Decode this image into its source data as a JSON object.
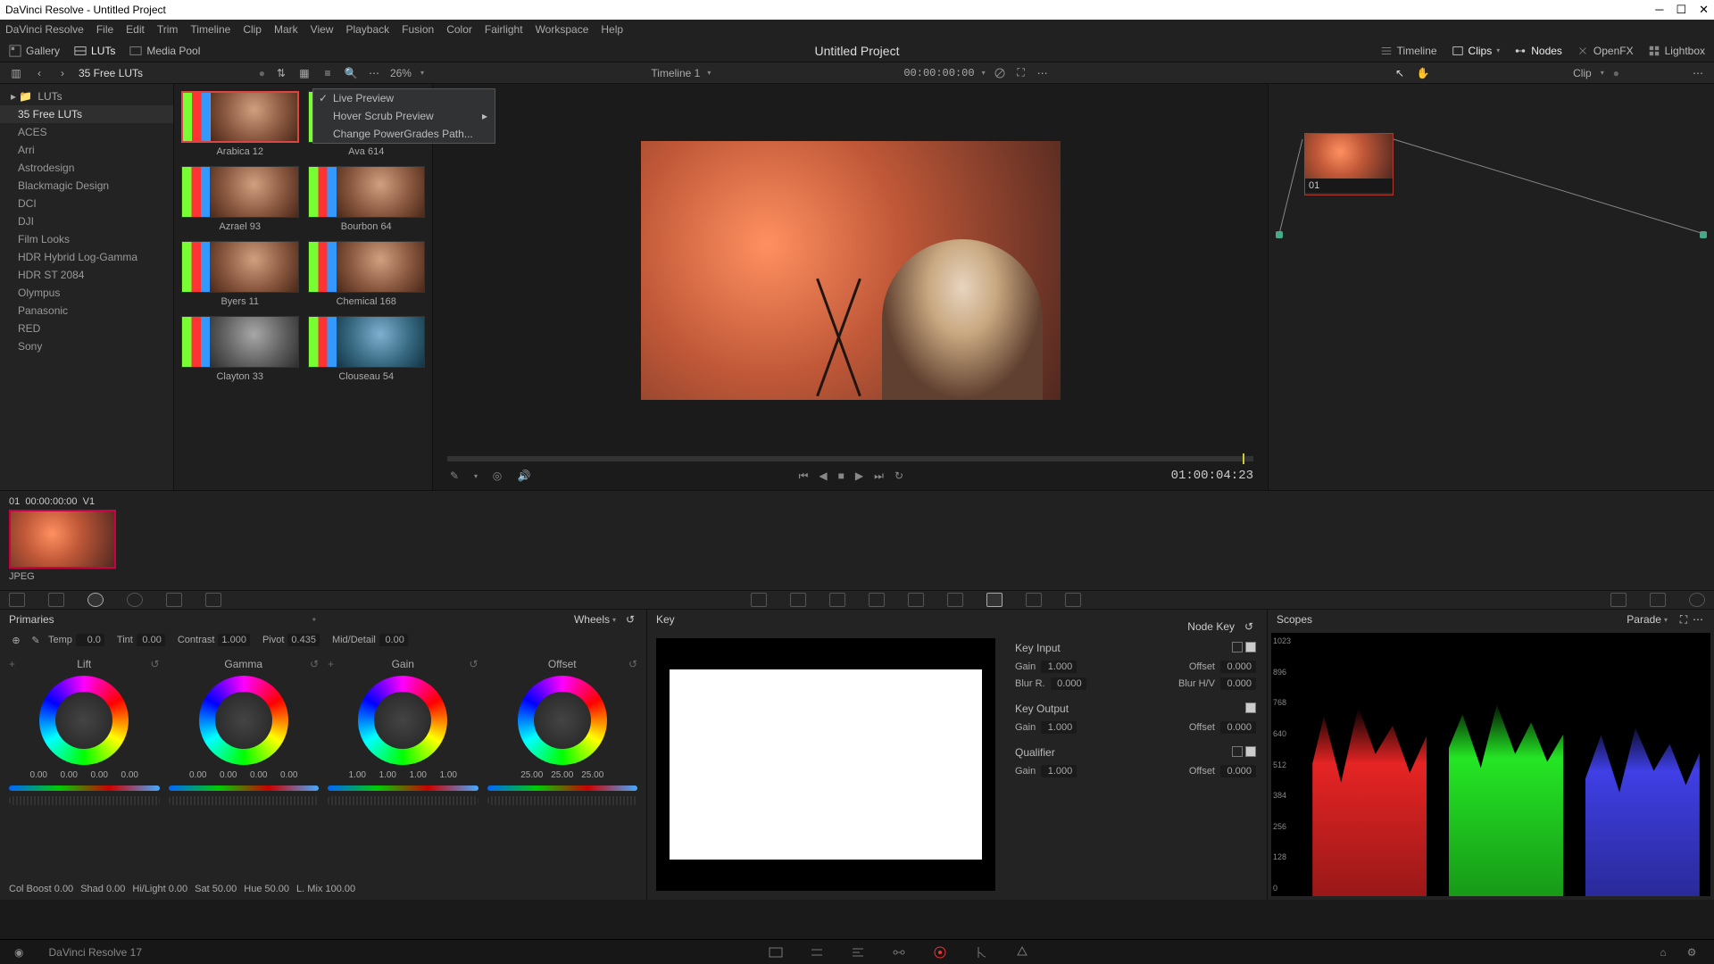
{
  "app": {
    "title": "DaVinci Resolve - Untitled Project",
    "version": "DaVinci Resolve 17"
  },
  "menus": [
    "DaVinci Resolve",
    "File",
    "Edit",
    "Trim",
    "Timeline",
    "Clip",
    "Mark",
    "View",
    "Playback",
    "Fusion",
    "Color",
    "Fairlight",
    "Workspace",
    "Help"
  ],
  "toolbar": {
    "gallery": "Gallery",
    "luts": "LUTs",
    "mediapool": "Media Pool",
    "project": "Untitled Project",
    "timeline": "Timeline",
    "clips": "Clips",
    "nodes": "Nodes",
    "openfx": "OpenFX",
    "lightbox": "Lightbox"
  },
  "secondary": {
    "lutset": "35 Free LUTs",
    "zoom": "26%",
    "timeline_name": "Timeline 1",
    "tc": "00:00:00:00",
    "clip_label": "Clip"
  },
  "ctx": {
    "live": "Live Preview",
    "hover": "Hover Scrub Preview",
    "path": "Change PowerGrades Path..."
  },
  "tree": {
    "root": "LUTs",
    "items": [
      "35 Free LUTs",
      "ACES",
      "Arri",
      "Astrodesign",
      "Blackmagic Design",
      "DCI",
      "DJI",
      "Film Looks",
      "HDR Hybrid Log-Gamma",
      "HDR ST 2084",
      "Olympus",
      "Panasonic",
      "RED",
      "Sony"
    ]
  },
  "luts": [
    {
      "name": "Arabica 12"
    },
    {
      "name": "Ava 614"
    },
    {
      "name": "Azrael 93"
    },
    {
      "name": "Bourbon 64"
    },
    {
      "name": "Byers 11"
    },
    {
      "name": "Chemical 168"
    },
    {
      "name": "Clayton 33"
    },
    {
      "name": "Clouseau 54"
    }
  ],
  "viewer": {
    "tc": "01:00:04:23"
  },
  "clip": {
    "num": "01",
    "tc": "00:00:00:00",
    "track": "V1",
    "fmt": "JPEG"
  },
  "node": {
    "label": "01"
  },
  "primaries": {
    "title": "Primaries",
    "mode": "Wheels",
    "sliders": {
      "temp_l": "Temp",
      "temp_v": "0.0",
      "tint_l": "Tint",
      "tint_v": "0.00",
      "contrast_l": "Contrast",
      "contrast_v": "1.000",
      "pivot_l": "Pivot",
      "pivot_v": "0.435",
      "mid_l": "Mid/Detail",
      "mid_v": "0.00"
    },
    "wheels": [
      {
        "name": "Lift",
        "nums": [
          "0.00",
          "0.00",
          "0.00",
          "0.00"
        ]
      },
      {
        "name": "Gamma",
        "nums": [
          "0.00",
          "0.00",
          "0.00",
          "0.00"
        ]
      },
      {
        "name": "Gain",
        "nums": [
          "1.00",
          "1.00",
          "1.00",
          "1.00"
        ]
      },
      {
        "name": "Offset",
        "nums": [
          "25.00",
          "25.00",
          "25.00"
        ]
      }
    ],
    "bottom": {
      "cb_l": "Col Boost",
      "cb_v": "0.00",
      "shad_l": "Shad",
      "shad_v": "0.00",
      "hl_l": "Hi/Light",
      "hl_v": "0.00",
      "sat_l": "Sat",
      "sat_v": "50.00",
      "hue_l": "Hue",
      "hue_v": "50.00",
      "lmix_l": "L. Mix",
      "lmix_v": "100.00"
    }
  },
  "key": {
    "title": "Key",
    "nodekey": "Node Key",
    "input_t": "Key Input",
    "output_t": "Key Output",
    "qual_t": "Qualifier",
    "gain_l": "Gain",
    "offset_l": "Offset",
    "blurr_l": "Blur R.",
    "blurhv_l": "Blur H/V",
    "v_gain": "1.000",
    "v_offset": "0.000",
    "v_blurr": "0.000",
    "v_blurhv": "0.000"
  },
  "scopes": {
    "title": "Scopes",
    "mode": "Parade",
    "ticks": [
      "1023",
      "896",
      "768",
      "640",
      "512",
      "384",
      "256",
      "128",
      "0"
    ]
  }
}
